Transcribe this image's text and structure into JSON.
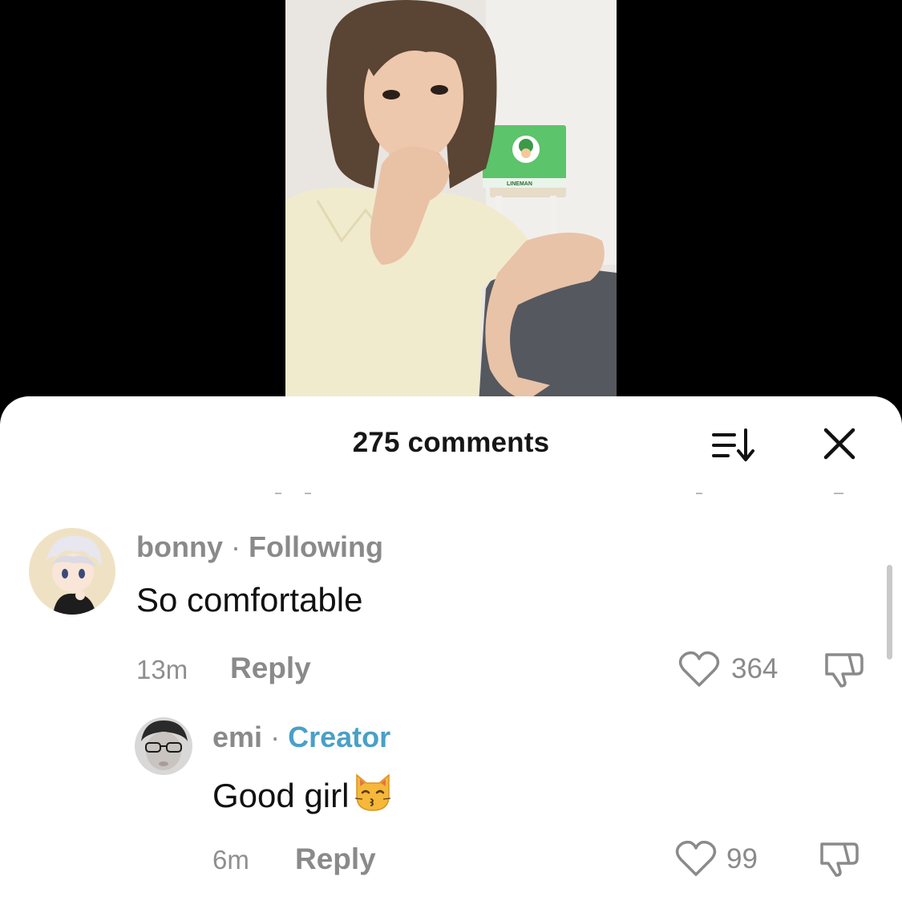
{
  "video": {
    "bag_brand": "LINEMAN"
  },
  "comments_sheet": {
    "title": "275 comments",
    "sort_icon": "sort-icon",
    "close_icon": "close-icon"
  },
  "comments": [
    {
      "avatar_icon": "anime-avatar",
      "username": "bonny",
      "separator": "·",
      "tag": "Following",
      "text": "So comfortable",
      "time": "13m",
      "reply_label": "Reply",
      "likes": "364"
    },
    {
      "avatar_icon": "photo-avatar",
      "username": "emi",
      "separator": "·",
      "tag": "Creator",
      "text": "Good girl",
      "emoji_icon": "kissing-cat-emoji",
      "time": "6m",
      "reply_label": "Reply",
      "likes": "99"
    }
  ],
  "colors": {
    "creator_tag": "#4a9fc8",
    "muted_text": "#8a8a8a",
    "sheet_background": "#ffffff",
    "video_background": "#000000"
  }
}
